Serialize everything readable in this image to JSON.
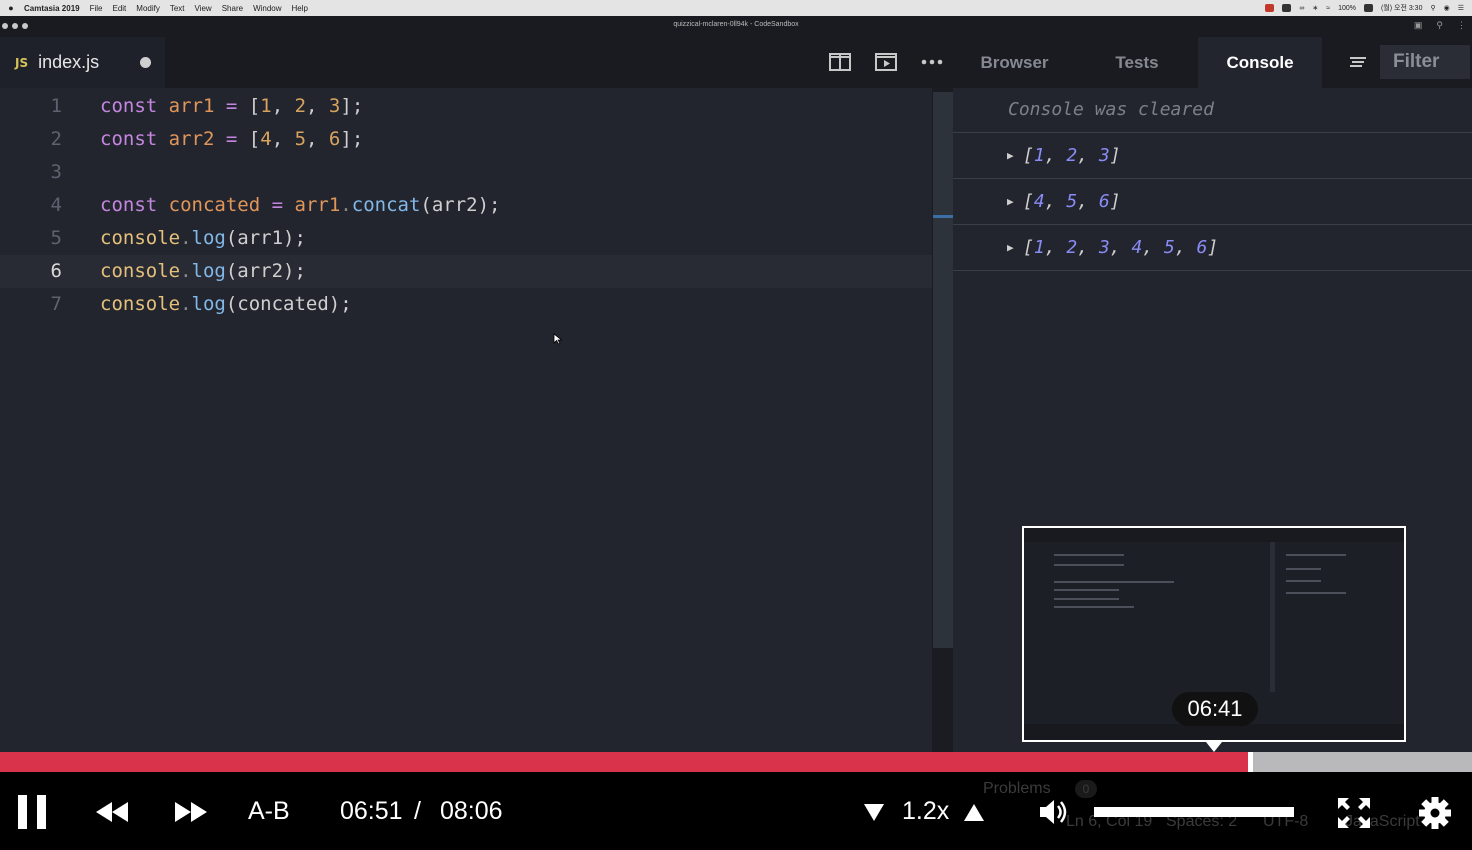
{
  "menubar": {
    "app_name": "Camtasia 2019",
    "menus": [
      "File",
      "Edit",
      "Modify",
      "Text",
      "View",
      "Share",
      "Window",
      "Help"
    ],
    "battery": "100%",
    "clock": "(월) 오전 3:30"
  },
  "window": {
    "title": "quizzical-mclaren-0ll94k - CodeSandbox"
  },
  "editor": {
    "tab": {
      "badge": "JS",
      "filename": "index.js"
    },
    "active_line": 6,
    "lines": [
      {
        "number": "1"
      },
      {
        "number": "2"
      },
      {
        "number": "3"
      },
      {
        "number": "4"
      },
      {
        "number": "5"
      },
      {
        "number": "6"
      },
      {
        "number": "7"
      }
    ],
    "code": {
      "l1": {
        "kw": "const",
        "name": "arr1",
        "op": "=",
        "open": "[",
        "a": "1",
        "b": "2",
        "c": "3",
        "close": "];"
      },
      "l2": {
        "kw": "const",
        "name": "arr2",
        "op": "=",
        "open": "[",
        "a": "4",
        "b": "5",
        "c": "6",
        "close": "];"
      },
      "l4": {
        "kw": "const",
        "name": "concated",
        "op": "=",
        "obj": "arr1",
        "method": "concat",
        "args": "(arr2);"
      },
      "l5": {
        "obj": "console",
        "method": "log",
        "args": "(arr1);"
      },
      "l6": {
        "obj": "console",
        "method": "log",
        "args": "(arr2);"
      },
      "l7": {
        "obj": "console",
        "method": "log",
        "args": "(concated);"
      }
    }
  },
  "panel": {
    "tabs": [
      "Browser",
      "Tests",
      "Console"
    ],
    "active_tab": "Console",
    "filter_placeholder": "Filter",
    "console": {
      "cleared_message": "Console was cleared",
      "logs": [
        {
          "values": [
            "1",
            "2",
            "3"
          ]
        },
        {
          "values": [
            "4",
            "5",
            "6"
          ]
        },
        {
          "values": [
            "1",
            "2",
            "3",
            "4",
            "5",
            "6"
          ]
        }
      ]
    }
  },
  "status_bar_ghost": {
    "problems": "Problems",
    "problems_count": "0",
    "cursor_pos": "Ln 6, Col 19",
    "spaces": "Spaces: 2",
    "encoding": "UTF-8",
    "language": "JavaScript"
  },
  "player": {
    "preview_time": "06:41",
    "current_time": "06:51",
    "separator": "/",
    "duration": "08:06",
    "ab_label": "A-B",
    "speed": "1.2x",
    "progress_fraction": 0.848,
    "volume_fraction": 1.0,
    "colors": {
      "progress": "#d9334b",
      "track": "#b9b9bb"
    }
  }
}
